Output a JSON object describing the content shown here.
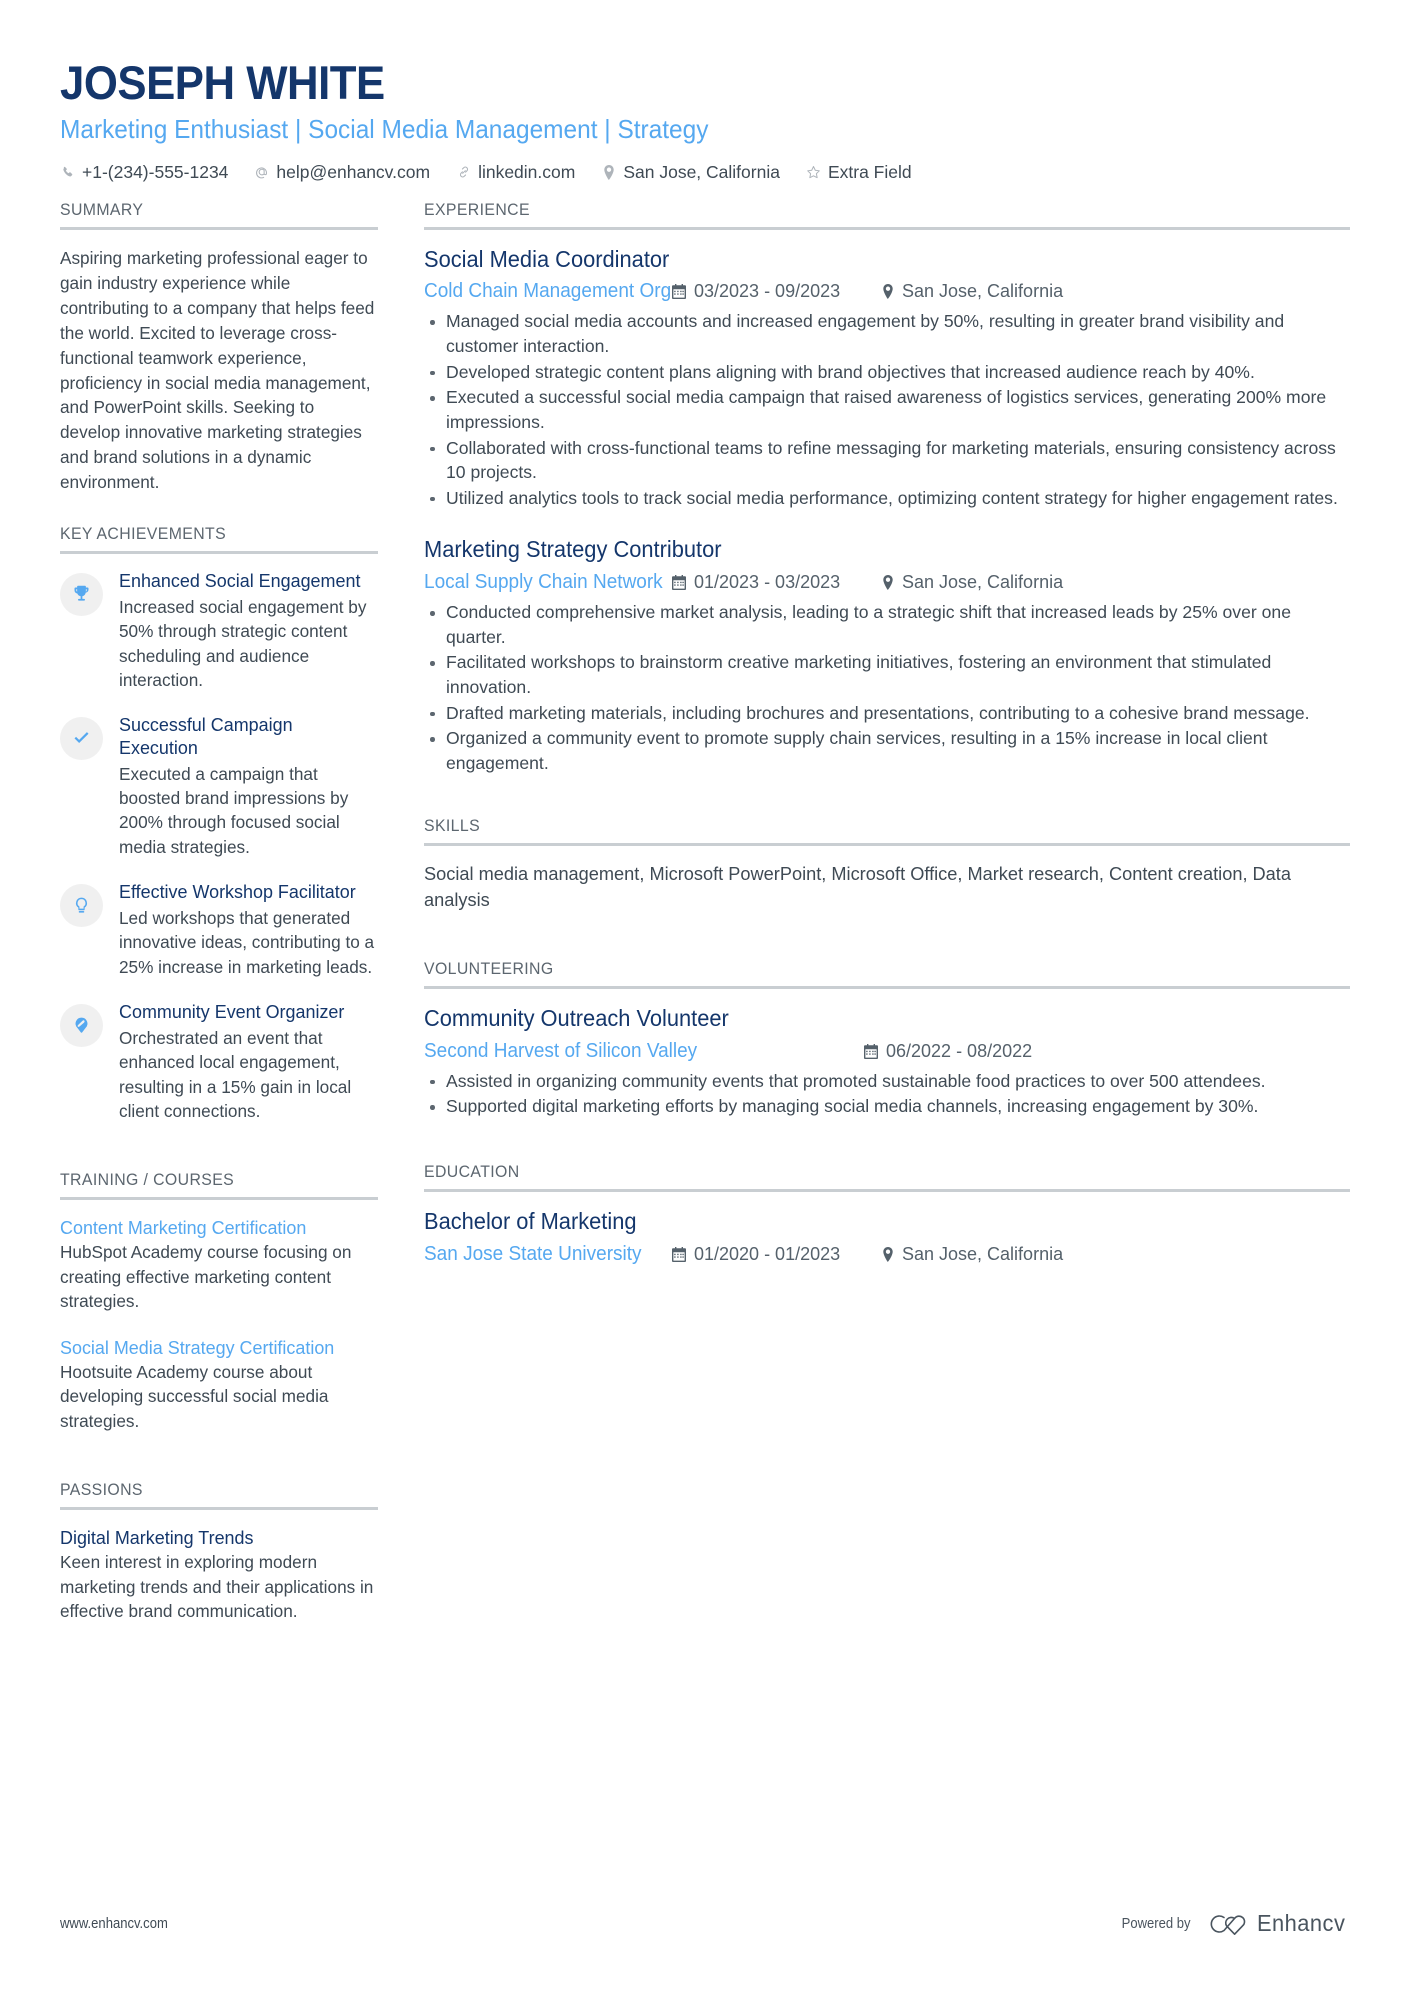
{
  "header": {
    "name": "JOSEPH WHITE",
    "headline": "Marketing Enthusiast | Social Media Management | Strategy",
    "contacts": [
      {
        "icon": "phone-icon",
        "text": "+1-(234)-555-1234"
      },
      {
        "icon": "email-icon",
        "text": "help@enhancv.com"
      },
      {
        "icon": "link-icon",
        "text": "linkedin.com"
      },
      {
        "icon": "location-pin-icon",
        "text": "San Jose, California"
      },
      {
        "icon": "star-icon",
        "text": "Extra Field"
      }
    ]
  },
  "left": {
    "summary": {
      "title": "SUMMARY",
      "text": "Aspiring marketing professional eager to gain industry experience while contributing to a company that helps feed the world. Excited to leverage cross-functional teamwork experience, proficiency in social media management, and PowerPoint skills. Seeking to develop innovative marketing strategies and brand solutions in a dynamic environment."
    },
    "achievements": {
      "title": "KEY ACHIEVEMENTS",
      "items": [
        {
          "icon": "trophy-icon",
          "title": "Enhanced Social Engagement",
          "desc": "Increased social engagement by 50% through strategic content scheduling and audience interaction."
        },
        {
          "icon": "check-icon",
          "title": "Successful Campaign Execution",
          "desc": "Executed a campaign that boosted brand impressions by 200% through focused social media strategies."
        },
        {
          "icon": "lightbulb-icon",
          "title": "Effective Workshop Facilitator",
          "desc": "Led workshops that generated innovative ideas, contributing to a 25% increase in marketing leads."
        },
        {
          "icon": "megaphone-icon",
          "title": "Community Event Organizer",
          "desc": "Orchestrated an event that enhanced local engagement, resulting in a 15% gain in local client connections."
        }
      ]
    },
    "training": {
      "title": "TRAINING / COURSES",
      "items": [
        {
          "title": "Content Marketing Certification",
          "desc": "HubSpot Academy course focusing on creating effective marketing content strategies."
        },
        {
          "title": "Social Media Strategy Certification",
          "desc": "Hootsuite Academy course about developing successful social media strategies."
        }
      ]
    },
    "passions": {
      "title": "PASSIONS",
      "items": [
        {
          "title": "Digital Marketing Trends",
          "desc": "Keen interest in exploring modern marketing trends and their applications in effective brand communication."
        }
      ]
    }
  },
  "right": {
    "experience": {
      "title": "EXPERIENCE",
      "jobs": [
        {
          "role": "Social Media Coordinator",
          "company": "Cold Chain Management Org",
          "dates": "03/2023 - 09/2023",
          "location": "San Jose, California",
          "bullets": [
            "Managed social media accounts and increased engagement by 50%, resulting in greater brand visibility and customer interaction.",
            "Developed strategic content plans aligning with brand objectives that increased audience reach by 40%.",
            "Executed a successful social media campaign that raised awareness of logistics services, generating 200% more impressions.",
            "Collaborated with cross-functional teams to refine messaging for marketing materials, ensuring consistency across 10 projects.",
            "Utilized analytics tools to track social media performance, optimizing content strategy for higher engagement rates."
          ]
        },
        {
          "role": "Marketing Strategy Contributor",
          "company": "Local Supply Chain Network",
          "dates": "01/2023 - 03/2023",
          "location": "San Jose, California",
          "bullets": [
            "Conducted comprehensive market analysis, leading to a strategic shift that increased leads by 25% over one quarter.",
            "Facilitated workshops to brainstorm creative marketing initiatives, fostering an environment that stimulated innovation.",
            "Drafted marketing materials, including brochures and presentations, contributing to a cohesive brand message.",
            "Organized a community event to promote supply chain services, resulting in a 15% increase in local client engagement."
          ]
        }
      ]
    },
    "skills": {
      "title": "SKILLS",
      "text": "Social media management, Microsoft PowerPoint, Microsoft Office, Market research, Content creation, Data analysis"
    },
    "volunteering": {
      "title": "VOLUNTEERING",
      "items": [
        {
          "role": "Community Outreach Volunteer",
          "company": "Second Harvest of Silicon Valley",
          "dates": "06/2022 - 08/2022",
          "location": "",
          "bullets": [
            "Assisted in organizing community events that promoted sustainable food practices to over 500 attendees.",
            "Supported digital marketing efforts by managing social media channels, increasing engagement by 30%."
          ]
        }
      ]
    },
    "education": {
      "title": "EDUCATION",
      "items": [
        {
          "degree": "Bachelor of Marketing",
          "school": "San Jose State University",
          "dates": "01/2020 - 01/2023",
          "location": "San Jose, California"
        }
      ]
    }
  },
  "footer": {
    "url": "www.enhancv.com",
    "powered_by": "Powered by",
    "brand": "Enhancv"
  },
  "colors": {
    "navy": "#14366b",
    "light_blue": "#55a8f0",
    "body_text": "#3f4a54",
    "rule": "#c9ced2",
    "badge_bg": "#f0f0f0"
  }
}
